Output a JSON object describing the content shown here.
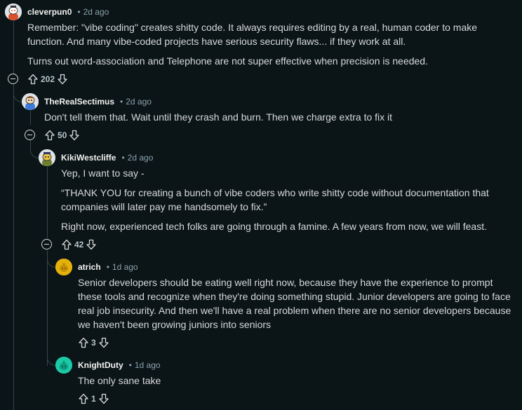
{
  "comments": [
    {
      "author": "cleverpun0",
      "time": "2d ago",
      "paragraphs": [
        "Remember: \"vibe coding\" creates shitty code. It always requires editing by a real, human coder to make function. And many vibe-coded projects have serious security flaws... if they work at all.",
        "Turns out word-association and Telephone are not super effective when precision is needed."
      ],
      "score": "202"
    },
    {
      "author": "TheRealSectimus",
      "time": "2d ago",
      "paragraphs": [
        "Don't tell them that. Wait until they crash and burn. Then we charge extra to fix it"
      ],
      "score": "50"
    },
    {
      "author": "KikiWestcliffe",
      "time": "2d ago",
      "paragraphs": [
        "Yep, I want to say -",
        "“THANK YOU for creating a bunch of vibe coders who write shitty code without documentation that companies will later pay me handsomely to fix.”",
        "Right now, experienced tech folks are going through a famine. A few years from now, we will feast."
      ],
      "score": "42"
    },
    {
      "author": "atrich",
      "time": "1d ago",
      "paragraphs": [
        "Senior developers should be eating well right now, because they have the experience to prompt these tools and recognize when they're doing something stupid. Junior developers are going to face real job insecurity. And then we'll have a real problem when there are no senior developers because we haven't been growing juniors into seniors"
      ],
      "score": "3"
    },
    {
      "author": "KnightDuty",
      "time": "1d ago",
      "paragraphs": [
        "The only sane take"
      ],
      "score": "1"
    }
  ],
  "separator": "•",
  "colors": {
    "background": "#0b1416",
    "thread_line": "#33464c",
    "meta_text": "#8ba2ad",
    "body_text": "#d7dadc"
  },
  "icons": {
    "upvote": "arrow-up-outline-icon",
    "downvote": "arrow-down-outline-icon",
    "collapse": "collapse-minus-icon"
  }
}
